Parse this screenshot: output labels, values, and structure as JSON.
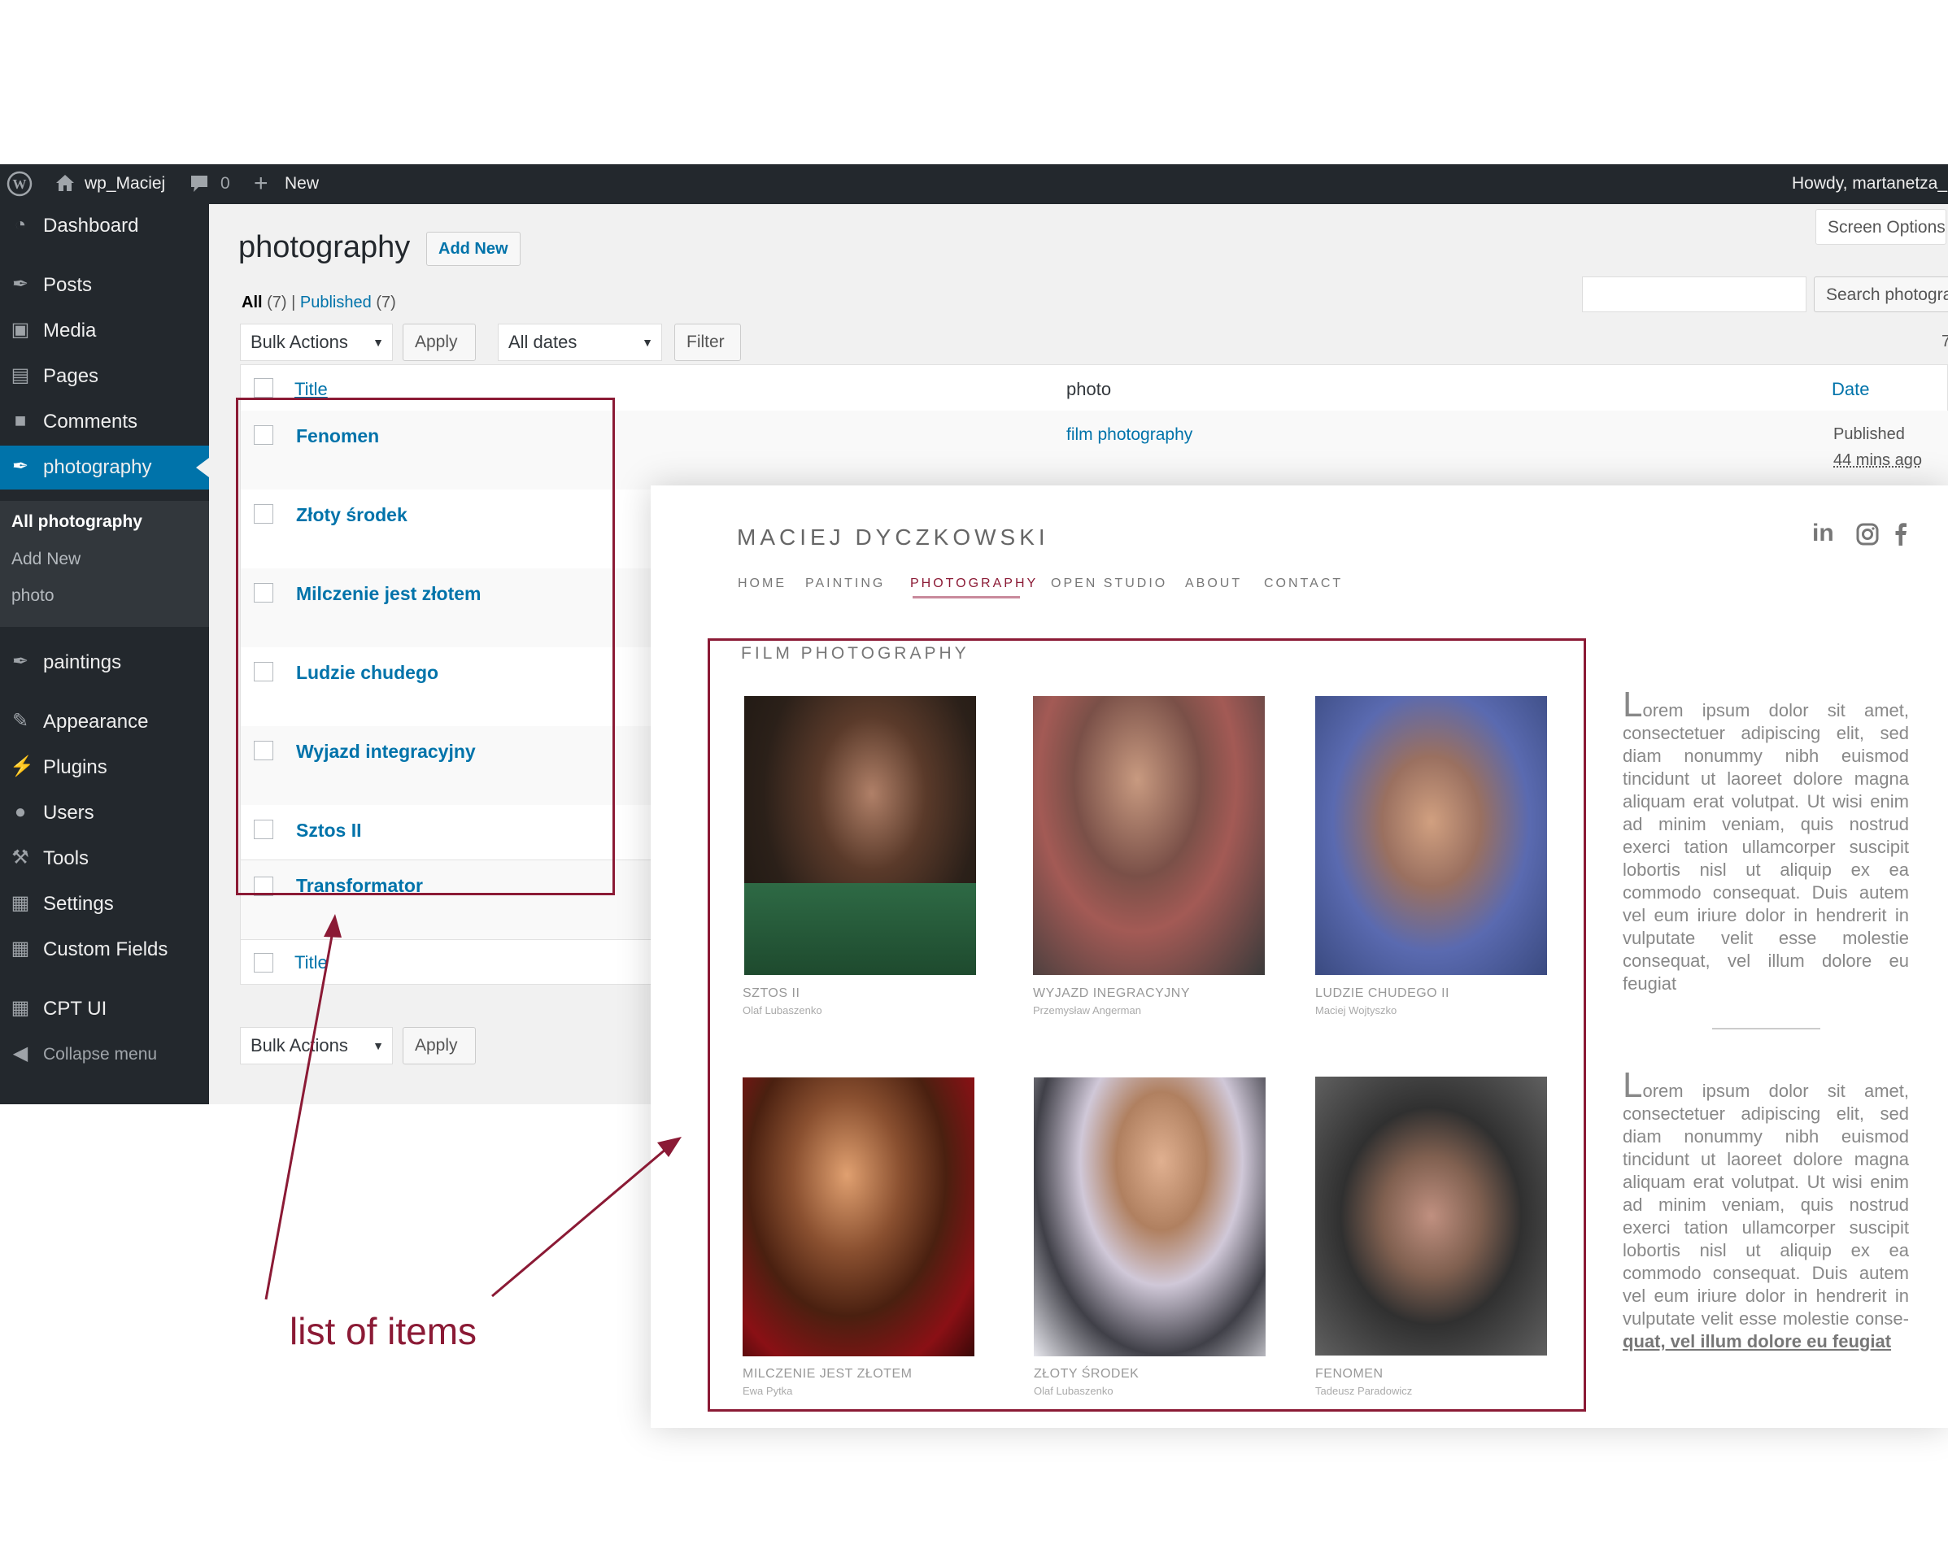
{
  "admin_bar": {
    "site_name": "wp_Maciej",
    "comments_count": "0",
    "new_label": "New",
    "greeting": "Howdy, martanetza_"
  },
  "sidebar": {
    "items": [
      {
        "label": "Dashboard",
        "icon": "dashboard-icon"
      },
      {
        "label": "Posts",
        "icon": "pin-icon"
      },
      {
        "label": "Media",
        "icon": "media-icon"
      },
      {
        "label": "Pages",
        "icon": "pages-icon"
      },
      {
        "label": "Comments",
        "icon": "comments-icon"
      },
      {
        "label": "photography",
        "icon": "pin-icon"
      },
      {
        "label": "paintings",
        "icon": "pin-icon"
      },
      {
        "label": "Appearance",
        "icon": "brush-icon"
      },
      {
        "label": "Plugins",
        "icon": "plug-icon"
      },
      {
        "label": "Users",
        "icon": "user-icon"
      },
      {
        "label": "Tools",
        "icon": "wrench-icon"
      },
      {
        "label": "Settings",
        "icon": "settings-icon"
      },
      {
        "label": "Custom Fields",
        "icon": "grid-icon"
      },
      {
        "label": "CPT UI",
        "icon": "grid-icon"
      },
      {
        "label": "Collapse menu",
        "icon": "collapse-icon"
      }
    ],
    "submenu": [
      "All photography",
      "Add New",
      "photo"
    ]
  },
  "page": {
    "title": "photography",
    "add_new": "Add New",
    "screen_options": "Screen Options",
    "search_button": "Search photography",
    "filter_all": "All",
    "filter_all_count": "(7)",
    "filter_separator": "|",
    "filter_published": "Published",
    "filter_published_count": "(7)",
    "bulk_actions": "Bulk Actions",
    "apply": "Apply",
    "all_dates": "All dates",
    "filter_button": "Filter",
    "items_count": "7"
  },
  "table": {
    "columns": [
      "Title",
      "photo",
      "Date"
    ],
    "rows": [
      {
        "title": "Fenomen",
        "photo": "film photography",
        "status": "Published",
        "date": "44 mins ago"
      },
      {
        "title": "Złoty środek"
      },
      {
        "title": "Milczenie jest złotem"
      },
      {
        "title": "Ludzie chudego"
      },
      {
        "title": "Wyjazd integracyjny"
      },
      {
        "title": "Sztos II"
      },
      {
        "title": "Transformator"
      }
    ],
    "footer_title": "Title"
  },
  "website": {
    "logo": "MACIEJ DYCZKOWSKI",
    "nav": [
      "HOME",
      "PAINTING",
      "PHOTOGRAPHY",
      "OPEN STUDIO",
      "ABOUT",
      "CONTACT"
    ],
    "active_nav": "PHOTOGRAPHY",
    "social": [
      "in"
    ],
    "section_title": "FILM PHOTOGRAPHY",
    "gallery": [
      {
        "title": "SZTOS II",
        "author": "Olaf Lubaszenko"
      },
      {
        "title": "WYJAZD INEGRACYJNY",
        "author": "Przemysław Angerman"
      },
      {
        "title": "LUDZIE CHUDEGO II",
        "author": "Maciej Wojtyszko"
      },
      {
        "title": "MILCZENIE JEST ZŁOTEM",
        "author": "Ewa Pytka"
      },
      {
        "title": "ZŁOTY ŚRODEK",
        "author": "Olaf Lubaszenko"
      },
      {
        "title": "FENOMEN",
        "author": "Tadeusz Paradowicz"
      }
    ],
    "lorem_cap": "L",
    "lorem_1": "orem ipsum dolor sit amet, consectetuer adipiscing elit, sed diam nonummy nibh euismod tincidunt ut laoreet dolore magna aliquam erat volutpat. Ut wisi enim ad minim veniam, quis nostrud exerci tation ullamcorper suscipit lobortis nisl ut aliquip ex ea commodo consequat. Duis autem vel eum iriure dolor in hendrerit in vulputate velit esse molestie consequat, vel illum dolore eu feugiat",
    "lorem_2_body": "orem ipsum dolor sit amet, consectetuer adipiscing elit, sed diam nonummy nibh euismod tincidunt ut laoreet dolore magna aliquam erat volutpat. Ut wisi enim ad minim veniam, quis nostrud exerci tation ullamcorper suscipit lobortis nisl ut aliquip ex ea commodo consequat. Duis autem vel eum iriure dolor in hendrerit in vulputate velit esse molestie conse-",
    "lorem_2_link": "quat, vel illum dolore eu feugiat"
  },
  "annotation": {
    "label": "list of items",
    "color": "#8b1a35"
  }
}
